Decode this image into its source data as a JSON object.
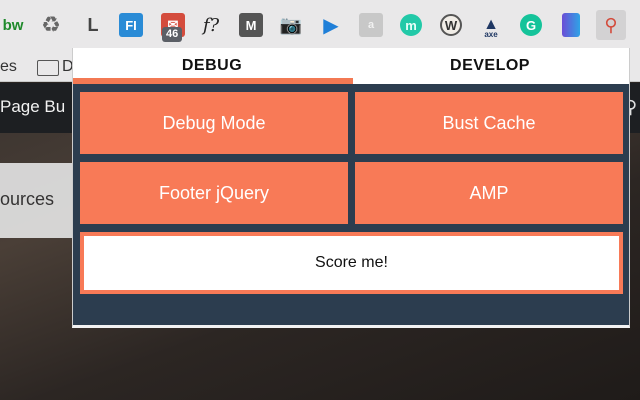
{
  "browser": {
    "extensions": [
      {
        "name": "bw",
        "label": "bw"
      },
      {
        "name": "recycle",
        "label": "♻"
      },
      {
        "name": "l",
        "label": "L"
      },
      {
        "name": "fi",
        "label": "FI"
      },
      {
        "name": "gmail",
        "label": "✉",
        "badge": "46"
      },
      {
        "name": "fq",
        "label": "f?"
      },
      {
        "name": "m",
        "label": "M"
      },
      {
        "name": "camera",
        "label": "📷"
      },
      {
        "name": "arrow",
        "label": "▶"
      },
      {
        "name": "ai",
        "label": "a"
      },
      {
        "name": "mcircle",
        "label": "m"
      },
      {
        "name": "w",
        "label": "W"
      },
      {
        "name": "axe",
        "label": "▲",
        "sub": "axe"
      },
      {
        "name": "g",
        "label": "G"
      },
      {
        "name": "book",
        "label": ""
      },
      {
        "name": "active",
        "label": "⚲"
      }
    ],
    "bookmarks": {
      "partial_label": "es",
      "folder_label": "D"
    }
  },
  "page": {
    "nav_label": "Page Bu",
    "sources_label": "ources"
  },
  "popup": {
    "tabs": [
      {
        "label": "DEBUG",
        "active": true
      },
      {
        "label": "DEVELOP",
        "active": false
      }
    ],
    "buttons": {
      "debug_mode": "Debug Mode",
      "bust_cache": "Bust Cache",
      "footer_jquery": "Footer jQuery",
      "amp": "AMP",
      "score_me": "Score me!"
    },
    "colors": {
      "accent": "#f87a57",
      "panel": "#2c3d4f"
    }
  }
}
